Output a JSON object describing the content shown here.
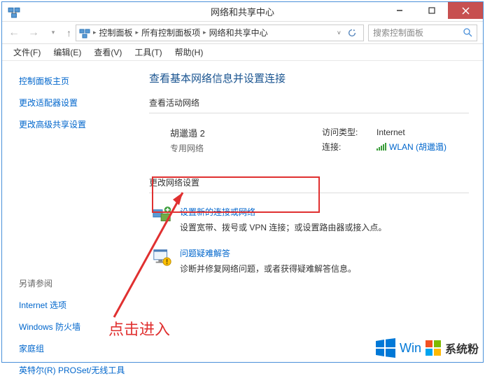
{
  "window": {
    "title": "网络和共享中心"
  },
  "breadcrumb": {
    "items": [
      "控制面板",
      "所有控制面板项",
      "网络和共享中心"
    ]
  },
  "search": {
    "placeholder": "搜索控制面板"
  },
  "menu": {
    "file": "文件(F)",
    "edit": "编辑(E)",
    "view": "查看(V)",
    "tools": "工具(T)",
    "help": "帮助(H)"
  },
  "sidebar": {
    "home": "控制面板主页",
    "adapter": "更改适配器设置",
    "advanced": "更改高级共享设置",
    "see_also_title": "另请参阅",
    "see_also": [
      "Internet 选项",
      "Windows 防火墙",
      "家庭组",
      "英特尔(R) PROSet/无线工具"
    ]
  },
  "main": {
    "heading": "查看基本网络信息并设置连接",
    "active_heading": "查看活动网络",
    "network": {
      "name": "胡邋遢  2",
      "type": "专用网络",
      "access_label": "访问类型:",
      "access_value": "Internet",
      "conn_label": "连接:",
      "conn_value": "WLAN (胡邋遢)"
    },
    "change_heading": "更改网络设置",
    "actions": [
      {
        "title": "设置新的连接或网络",
        "desc": "设置宽带、拨号或 VPN 连接；或设置路由器或接入点。"
      },
      {
        "title": "问题疑难解答",
        "desc": "诊断并修复网络问题，或者获得疑难解答信息。"
      }
    ]
  },
  "annotation": {
    "text": "点击进入"
  },
  "watermark": {
    "win": "Win",
    "brand": "系统粉"
  }
}
